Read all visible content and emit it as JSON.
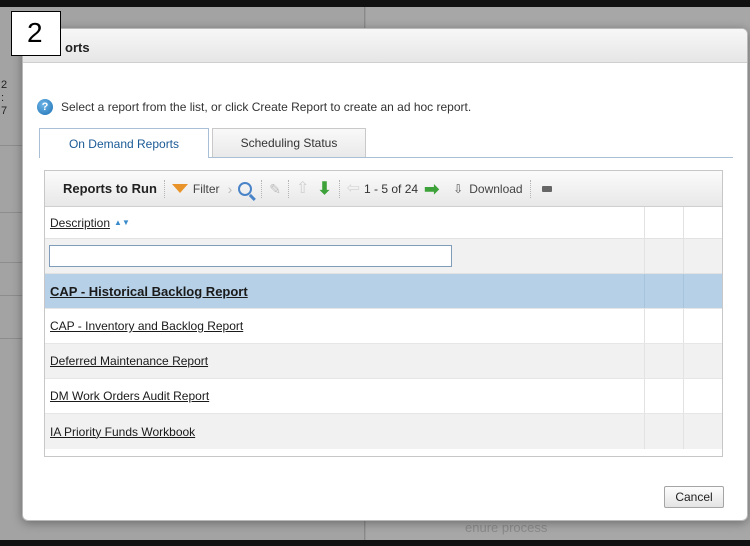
{
  "annotation": {
    "step_number": "2"
  },
  "background": {
    "left_chars": [
      "2",
      ":",
      "7"
    ],
    "footer_text": "enure process"
  },
  "dialog": {
    "title": "orts",
    "info_text": "Select a report from the list, or click Create Report to create an ad hoc report.",
    "help_icon_glyph": "?",
    "tabs": [
      {
        "label": "On Demand Reports",
        "active": true
      },
      {
        "label": "Scheduling Status",
        "active": false
      }
    ],
    "grid": {
      "toolbar": {
        "title": "Reports to Run",
        "filter_label": "Filter",
        "pager_text": "1 - 5 of 24",
        "download_label": "Download"
      },
      "column_header": "Description",
      "rows": [
        {
          "label": "CAP - Historical Backlog Report",
          "selected": true
        },
        {
          "label": "CAP - Inventory and Backlog Report",
          "selected": false
        },
        {
          "label": "Deferred Maintenance Report",
          "selected": false
        },
        {
          "label": "DM Work Orders Audit Report",
          "selected": false
        },
        {
          "label": "IA Priority Funds Workbook",
          "selected": false
        }
      ]
    },
    "cancel_label": "Cancel"
  }
}
